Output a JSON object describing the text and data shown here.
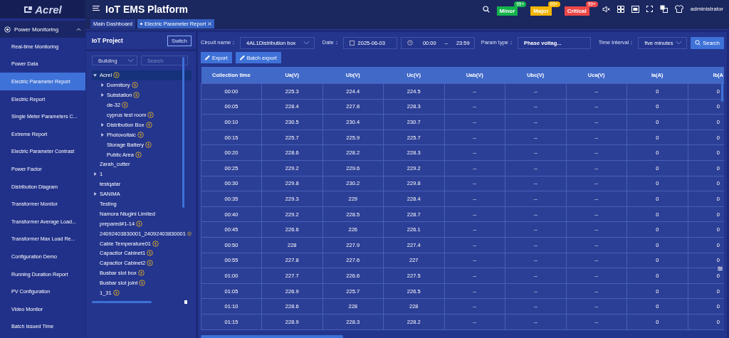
{
  "logo": {
    "text": "Acrel"
  },
  "header": {
    "title": "IoT EMS Platform",
    "alarms": [
      {
        "label": "Minor",
        "count": "99+",
        "color": "#14b24c"
      },
      {
        "label": "Major",
        "count": "99+",
        "color": "#f4b400"
      },
      {
        "label": "Critical",
        "count": "99+",
        "color": "#ee4747"
      }
    ],
    "user": "administrator"
  },
  "tabs": [
    {
      "label": "Main Dashboard",
      "selected": false,
      "closable": false
    },
    {
      "label": "Electric Parameter Report",
      "selected": true,
      "closable": true
    }
  ],
  "sidebar": {
    "group": {
      "label": "Power Monitoring",
      "expanded": true
    },
    "items": [
      {
        "label": "Real-time Monitoring",
        "selected": false
      },
      {
        "label": "Power Data",
        "selected": false
      },
      {
        "label": "Electric Parameter Report",
        "selected": true
      },
      {
        "label": "Electric Report",
        "selected": false
      },
      {
        "label": "Single Meter Parameters C...",
        "selected": false
      },
      {
        "label": "Extreme Report",
        "selected": false
      },
      {
        "label": "Electric Parameter Contrast",
        "selected": false
      },
      {
        "label": "Power Factor",
        "selected": false
      },
      {
        "label": "Distribution Diagram",
        "selected": false
      },
      {
        "label": "Transformer Monitor",
        "selected": false
      },
      {
        "label": "Transformer Average Load...",
        "selected": false
      },
      {
        "label": "Transformer Max Load Re...",
        "selected": false
      },
      {
        "label": "Configuration Demo",
        "selected": false
      },
      {
        "label": "Running Duration Report",
        "selected": false
      },
      {
        "label": "PV Configuration",
        "selected": false
      },
      {
        "label": "Video Montior",
        "selected": false
      },
      {
        "label": "Batch Issued Time",
        "selected": false
      }
    ]
  },
  "project": {
    "title": "IoT Project",
    "switch_label": "Switch",
    "filter": {
      "value": "Building"
    },
    "search": {
      "placeholder": "Search"
    },
    "tree": [
      {
        "label": "Acrel",
        "bolt": true,
        "expandable": true,
        "expanded": true,
        "selected": true,
        "children": [
          {
            "label": "Dormitory",
            "bolt": true,
            "expandable": true,
            "expanded": false,
            "selected": false
          },
          {
            "label": "Substation",
            "bolt": true,
            "expandable": true,
            "expanded": false,
            "selected": false
          },
          {
            "label": "de-32",
            "bolt": true,
            "expandable": false,
            "selected": false
          },
          {
            "label": "cyprus test room",
            "bolt": true,
            "expandable": false,
            "selected": false
          },
          {
            "label": "Distribution Box",
            "bolt": true,
            "expandable": true,
            "expanded": false,
            "selected": false
          },
          {
            "label": "Photovoltaic",
            "bolt": true,
            "expandable": true,
            "expanded": false,
            "selected": false
          },
          {
            "label": "Storage Battery",
            "bolt": true,
            "expandable": false,
            "selected": false
          },
          {
            "label": "Public Area",
            "bolt": true,
            "expandable": false,
            "selected": false
          }
        ]
      },
      {
        "label": "Zarah_cutter",
        "bolt": false,
        "expandable": false,
        "selected": false
      },
      {
        "label": "1",
        "bolt": false,
        "expandable": true,
        "expanded": false,
        "selected": false
      },
      {
        "label": "testqatar",
        "bolt": false,
        "expandable": false,
        "selected": false
      },
      {
        "label": "SANIMA",
        "bolt": false,
        "expandable": true,
        "expanded": false,
        "selected": false
      },
      {
        "label": "Testing",
        "bolt": false,
        "expandable": false,
        "selected": false
      },
      {
        "label": "Namora Niugini Limited",
        "bolt": false,
        "expandable": false,
        "selected": false
      },
      {
        "label": "prepared#1-14",
        "bolt": true,
        "expandable": false,
        "selected": false
      },
      {
        "label": "24092403830001_24092403830001",
        "bolt": true,
        "expandable": false,
        "selected": false
      },
      {
        "label": "Cable Temperature01",
        "bolt": true,
        "expandable": false,
        "selected": false
      },
      {
        "label": "Capacitor Cabinet1",
        "bolt": true,
        "expandable": false,
        "selected": false
      },
      {
        "label": "Capacitor Cabinet2",
        "bolt": true,
        "expandable": false,
        "selected": false
      },
      {
        "label": "Busbar slot box",
        "bolt": true,
        "expandable": false,
        "selected": false
      },
      {
        "label": "Busbar slot joint",
        "bolt": true,
        "expandable": false,
        "selected": false
      },
      {
        "label": "1_31",
        "bolt": true,
        "expandable": false,
        "selected": false
      }
    ]
  },
  "filters": {
    "circuit": {
      "label": "Circuit name：",
      "value": "4AL1Distribution box"
    },
    "date": {
      "label": "Date：",
      "value": "2025-06-03"
    },
    "time_range": {
      "start": "00:00",
      "separator": "–",
      "end": "23:59"
    },
    "param_type": {
      "label": "Param type：",
      "value": "Phase voltag..."
    },
    "interval": {
      "label": "Time interval：",
      "value": "five minutes"
    },
    "search_button": "Search"
  },
  "actions": [
    "Export",
    "Batch export"
  ],
  "table": {
    "columns": [
      "Collection time",
      "Ua(V)",
      "Ub(V)",
      "Uc(V)",
      "Uab(V)",
      "Ubc(V)",
      "Uca(V)",
      "Ia(A)",
      "Ib(A"
    ],
    "rows": [
      [
        "00:00",
        "225.3",
        "224.4",
        "224.5",
        "--",
        "--",
        "--",
        "0",
        "0"
      ],
      [
        "00:05",
        "228.4",
        "227.8",
        "228.3",
        "--",
        "--",
        "--",
        "0",
        "0"
      ],
      [
        "00:10",
        "230.5",
        "230.4",
        "230.7",
        "--",
        "--",
        "--",
        "0",
        "0"
      ],
      [
        "00:15",
        "225.7",
        "225.9",
        "225.7",
        "--",
        "--",
        "--",
        "0",
        "0"
      ],
      [
        "00:20",
        "228.6",
        "228.2",
        "228.3",
        "--",
        "--",
        "--",
        "0",
        "0"
      ],
      [
        "00:25",
        "229.2",
        "229.6",
        "229.2",
        "--",
        "--",
        "--",
        "0",
        "0"
      ],
      [
        "00:30",
        "229.8",
        "230.2",
        "229.8",
        "--",
        "--",
        "--",
        "0",
        "0"
      ],
      [
        "00:35",
        "229.3",
        "229",
        "228.4",
        "--",
        "--",
        "--",
        "0",
        "0"
      ],
      [
        "00:40",
        "229.2",
        "228.5",
        "228.7",
        "--",
        "--",
        "--",
        "0",
        "0"
      ],
      [
        "00:45",
        "226.6",
        "226",
        "226.1",
        "--",
        "--",
        "--",
        "0",
        "0"
      ],
      [
        "00:50",
        "228",
        "227.9",
        "227.4",
        "--",
        "--",
        "--",
        "0",
        "0"
      ],
      [
        "00:55",
        "227.8",
        "227.6",
        "227",
        "--",
        "--",
        "--",
        "0",
        "0"
      ],
      [
        "01:00",
        "227.7",
        "226.6",
        "227.5",
        "--",
        "--",
        "--",
        "0",
        "0"
      ],
      [
        "01:05",
        "226.9",
        "225.7",
        "226.5",
        "--",
        "--",
        "--",
        "0",
        "0"
      ],
      [
        "01:10",
        "228.6",
        "228",
        "228",
        "--",
        "--",
        "--",
        "0",
        "0"
      ],
      [
        "01:15",
        "228.9",
        "228.3",
        "228.2",
        "--",
        "--",
        "--",
        "0",
        "0"
      ]
    ]
  }
}
